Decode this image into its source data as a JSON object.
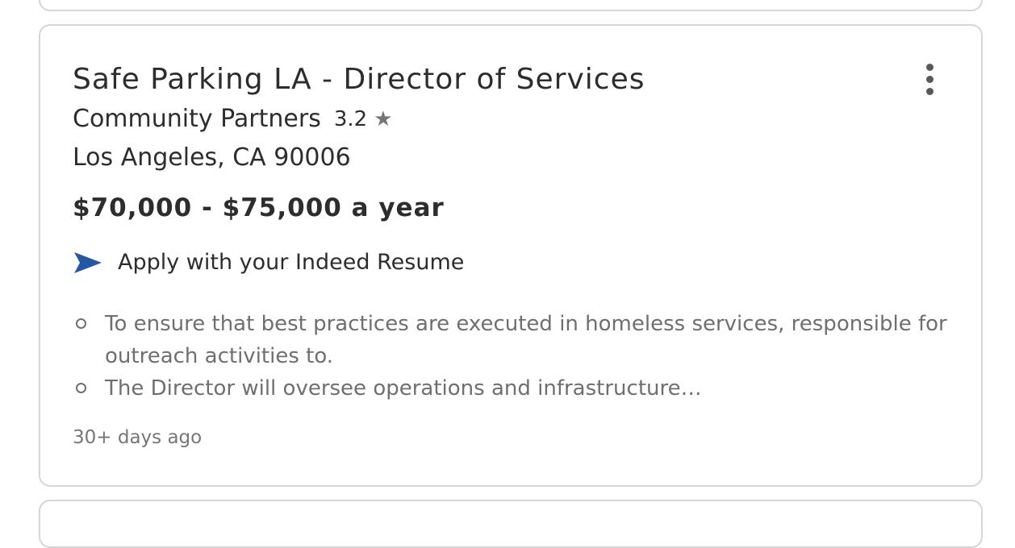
{
  "job": {
    "title": "Safe Parking LA - Director of Services",
    "company": "Community Partners",
    "rating": "3.2",
    "rating_icon": "star-icon",
    "location": "Los Angeles, CA 90006",
    "salary": "$70,000 - $75,000 a year",
    "apply_label": "Apply with your Indeed Resume",
    "apply_icon": "send-arrow-icon",
    "snippet": [
      "To ensure that best practices are executed in homeless services, responsible for outreach activities to.",
      "The Director will oversee operations and infrastructure…"
    ],
    "posted": "30+ days ago",
    "more_icon": "more-vertical-icon"
  },
  "colors": {
    "text_primary": "#2d2d2d",
    "text_secondary": "#6f6f6f",
    "apply_icon": "#2557a7",
    "card_border": "#d6d6d6"
  }
}
